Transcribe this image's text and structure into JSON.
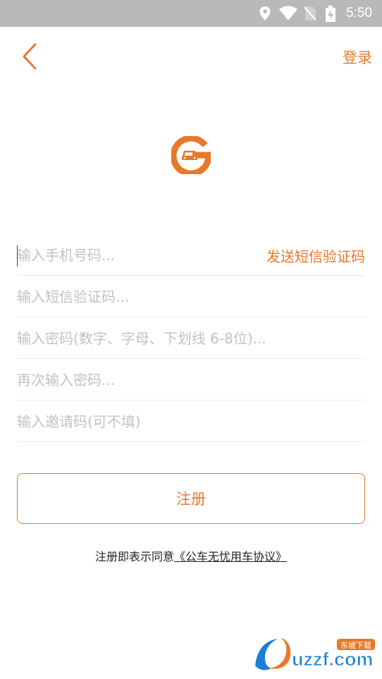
{
  "status_bar": {
    "time": "5:50"
  },
  "header": {
    "login_label": "登录"
  },
  "form": {
    "phone_placeholder": "输入手机号码...",
    "send_code_label": "发送短信验证码",
    "sms_code_placeholder": "输入短信验证码...",
    "password_placeholder": "输入密码(数字、字母、下划线 6-8位)...",
    "password_confirm_placeholder": "再次输入密码...",
    "invite_code_placeholder": "输入邀请码(可不填)"
  },
  "register_button_label": "注册",
  "agreement": {
    "prefix": "注册即表示同意",
    "link": "《公车无忧用车协议》"
  },
  "watermark": {
    "brand": "uzzf.com",
    "tag": "东坡下载"
  },
  "colors": {
    "accent": "#e8782a",
    "status_bar": "#b9b9b9",
    "placeholder": "#c2c2c2"
  }
}
